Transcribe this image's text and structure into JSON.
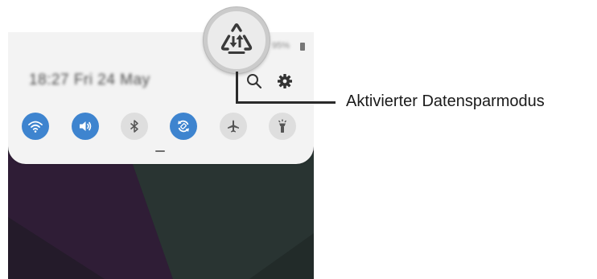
{
  "quick_panel": {
    "clock_text": "18:27  Fri 24 May",
    "status_text": "95%",
    "search_button": "search-icon",
    "settings_button": "gear-icon",
    "toggles": [
      {
        "name": "wifi",
        "icon": "wifi-icon",
        "active": true
      },
      {
        "name": "sound",
        "icon": "speaker-icon",
        "active": true
      },
      {
        "name": "bluetooth",
        "icon": "bluetooth-icon",
        "active": false
      },
      {
        "name": "auto-rotate",
        "icon": "rotate-icon",
        "active": true
      },
      {
        "name": "airplane-mode",
        "icon": "airplane-icon",
        "active": false
      },
      {
        "name": "flashlight",
        "icon": "flashlight-icon",
        "active": false
      }
    ]
  },
  "callout": {
    "icon": "data-saver-icon",
    "label": "Aktivierter Datensparmodus"
  },
  "colors": {
    "toggle_on": "#3e84cf",
    "toggle_off": "#dedede",
    "panel_bg": "#f3f3f3"
  }
}
